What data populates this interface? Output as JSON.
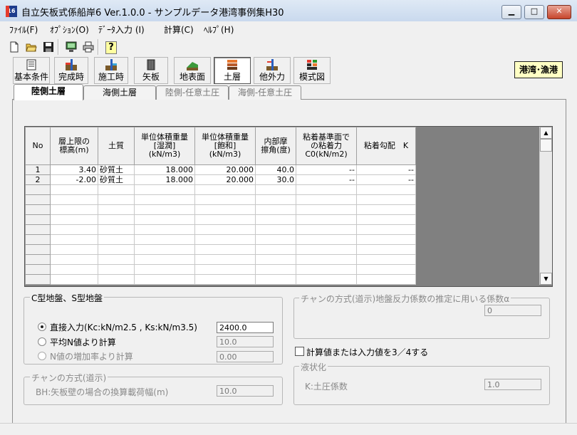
{
  "window": {
    "title": "自立矢板式係船岸6 Ver.1.0.0 - サンプルデータ港湾事例集H30",
    "app_icon": "16",
    "minimize": "▁",
    "maximize": "□",
    "close": "✕"
  },
  "menu": [
    "ﾌｧｲﾙ(F)",
    "ｵﾌﾟｼｮﾝ(O)",
    "ﾃﾞｰﾀ入力 (I)",
    "計算(C)",
    "ﾍﾙﾌﾟ(H)"
  ],
  "toolbar_small_icons": [
    "new-file-icon",
    "open-folder-icon",
    "save-disk-icon",
    "monitor-icon",
    "printer-icon",
    "help-question-icon"
  ],
  "toolbar": {
    "help_glyph": "?",
    "buttons": [
      "基本条件",
      "完成時",
      "施工時",
      "矢板",
      "地表面",
      "土層",
      "他外力",
      "模式図"
    ],
    "active": "土層"
  },
  "badge": "港湾･漁港",
  "tabs": [
    "陸側土層",
    "海側土層",
    "陸側-任意土圧",
    "海側-任意土圧"
  ],
  "grid": {
    "headers": [
      "No",
      "層上限の\n標高(m)",
      "土質",
      "単位体積重量\n[湿潤]\n(kN/m3)",
      "単位体積重量\n[飽和]\n(kN/m3)",
      "内部摩\n擦角(度)",
      "粘着基準面で\nの粘着力\nC0(kN/m2)",
      "粘着勾配　K"
    ],
    "rows": [
      [
        "1",
        "3.40",
        "砂質土",
        "18.000",
        "20.000",
        "40.0",
        "--",
        "--"
      ],
      [
        "2",
        "-2.00",
        "砂質土",
        "18.000",
        "20.000",
        "30.0",
        "--",
        "--"
      ]
    ],
    "scroll_up": "▲",
    "scroll_down": "▼"
  },
  "group_cs": {
    "title": "C型地盤、S型地盤",
    "options": [
      {
        "label": "直接入力(Kc:kN/m2.5 , Ks:kN/m3.5)",
        "value": "2400.0",
        "selected": true,
        "enabled": true
      },
      {
        "label": "平均N値より計算",
        "value": "10.0",
        "selected": false,
        "enabled": true
      },
      {
        "label": "N値の増加率より計算",
        "value": "0.00",
        "selected": false,
        "enabled": false
      }
    ]
  },
  "group_chang_bh": {
    "title": "チャンの方式(道示)",
    "label": "BH:矢板壁の場合の換算載荷幅(m)",
    "value": "10.0"
  },
  "group_chang_alpha": {
    "title": "チャンの方式(道示)地盤反力係数の推定に用いる係数α",
    "value": "0"
  },
  "checkbox_34": {
    "label": "計算値または入力値を3／4する",
    "checked": false
  },
  "group_liquefaction": {
    "title": "液状化",
    "label": "K:土圧係数",
    "value": "1.0"
  }
}
